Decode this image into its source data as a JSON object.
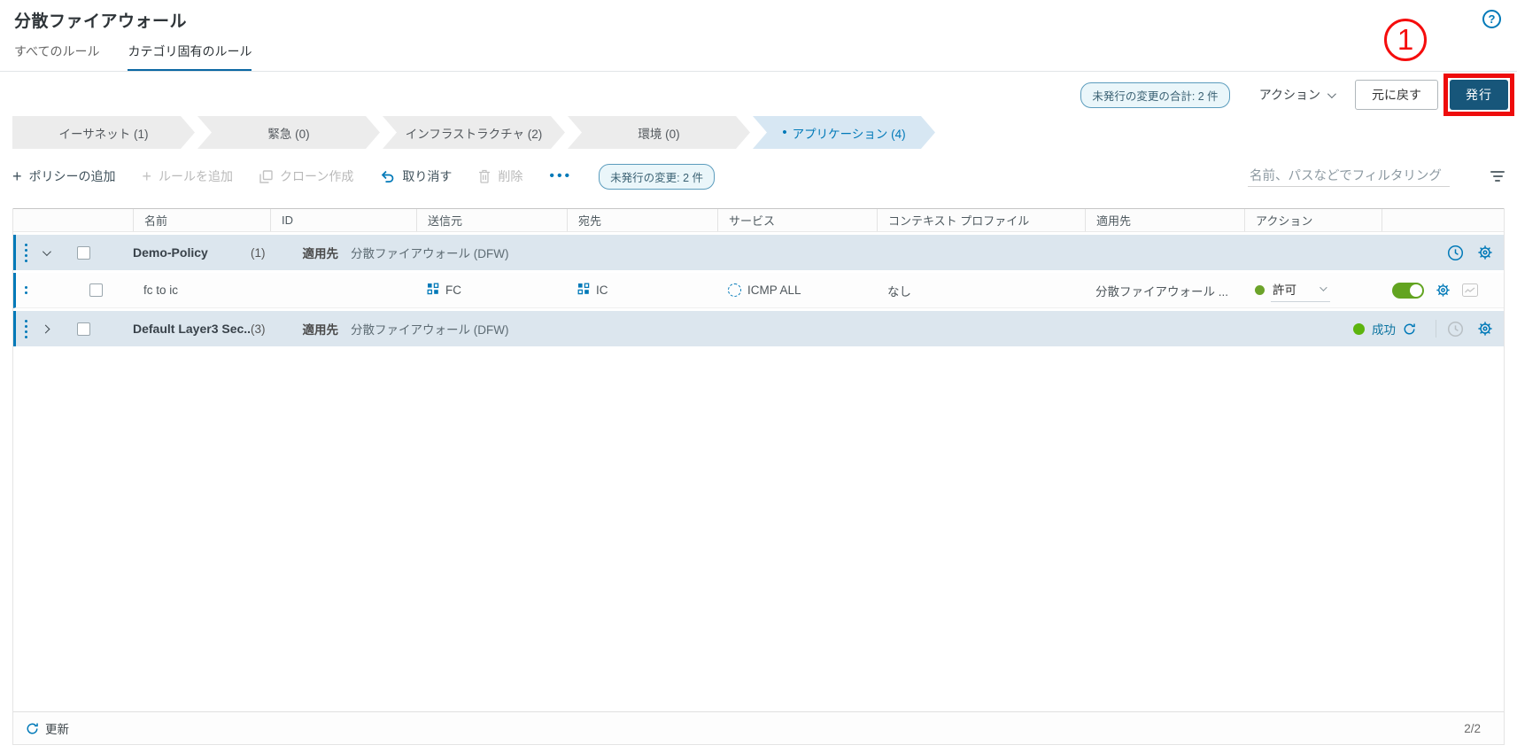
{
  "header": {
    "title": "分散ファイアウォール"
  },
  "tabs": [
    {
      "label": "すべてのルール",
      "active": false
    },
    {
      "label": "カテゴリ固有のルール",
      "active": true
    }
  ],
  "action_bar": {
    "unpublished_total_badge": "未発行の変更の合計: 2 件",
    "actions_label": "アクション",
    "revert_label": "元に戻す",
    "publish_label": "発行",
    "annotation_number": "1"
  },
  "categories": [
    {
      "label": "イーサネット (1)",
      "active": false
    },
    {
      "label": "緊急 (0)",
      "active": false
    },
    {
      "label": "インフラストラクチャ (2)",
      "active": false
    },
    {
      "label": "環境 (0)",
      "active": false
    },
    {
      "label": "アプリケーション (4)",
      "active": true,
      "bullet": "•"
    }
  ],
  "toolbar": {
    "add_policy": "ポリシーの追加",
    "add_rule": "ルールを追加",
    "clone": "クローン作成",
    "undo": "取り消す",
    "delete": "削除",
    "more": "•••",
    "unpublished_badge": "未発行の変更: 2 件",
    "filter_placeholder": "名前、パスなどでフィルタリング"
  },
  "table": {
    "headers": [
      "名前",
      "ID",
      "送信元",
      "宛先",
      "サービス",
      "コンテキスト プロファイル",
      "適用先",
      "アクション"
    ],
    "policy_rows": [
      {
        "name": "Demo-Policy",
        "count": "(1)",
        "applied_label": "適用先",
        "applied_value": "分散ファイアウォール (DFW)"
      },
      {
        "name": "Default Layer3 Sec...",
        "count": "(3)",
        "applied_label": "適用先",
        "applied_value": "分散ファイアウォール (DFW)",
        "status": "成功"
      }
    ],
    "rule_rows": [
      {
        "name": "fc to ic",
        "source": "FC",
        "destination": "IC",
        "service": "ICMP ALL",
        "context_profile": "なし",
        "applied_to": "分散ファイアウォール ...",
        "action": "許可"
      }
    ]
  },
  "footer": {
    "refresh_label": "更新",
    "page_indicator": "2/2"
  },
  "colors": {
    "primary_blue": "#0079b8",
    "publish_button": "#17567a",
    "selected_row_bg": "#dce6ee",
    "category_active_bg": "#d7e7f3",
    "success_green": "#5cb40e",
    "annotation_red": "#ee0c0c"
  }
}
